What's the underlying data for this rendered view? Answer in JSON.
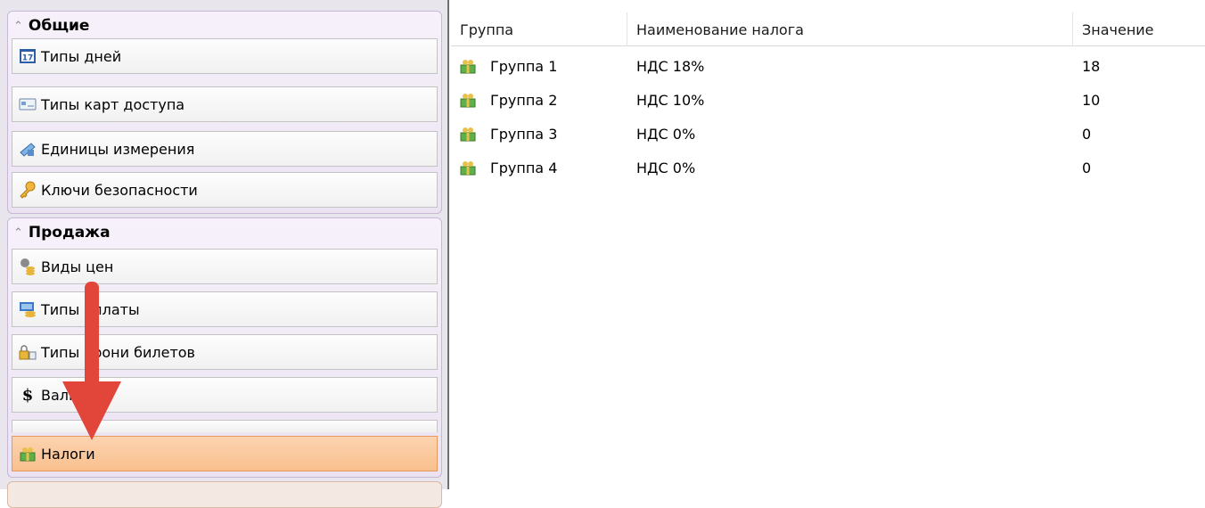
{
  "nav": {
    "general": {
      "title": "Общие",
      "items": [
        {
          "label": "Типы дней",
          "icon": "calendar-icon"
        },
        {
          "label": "Типы карт доступа",
          "icon": "access-card-icon"
        },
        {
          "label": "Единицы измерения",
          "icon": "measure-units-icon"
        },
        {
          "label": "Ключи безопасности",
          "icon": "key-icon"
        }
      ]
    },
    "sales": {
      "title": "Продажа",
      "items": [
        {
          "label": "Виды цен",
          "icon": "coins-icon"
        },
        {
          "label": "Типы оплаты",
          "icon": "payment-icon"
        },
        {
          "label": "Типы брони билетов",
          "icon": "lock-tickets-icon"
        },
        {
          "label": "Валюта",
          "icon": "dollar-icon"
        },
        {
          "label": "Налоги",
          "icon": "tax-gift-icon",
          "selected": true
        }
      ]
    }
  },
  "grid": {
    "columns": [
      "Группа",
      "Наименование налога",
      "Значение"
    ],
    "rows": [
      {
        "group": "Группа 1",
        "name": "НДС 18%",
        "value": "18"
      },
      {
        "group": "Группа 2",
        "name": "НДС 10%",
        "value": "10"
      },
      {
        "group": "Группа 3",
        "name": "НДС 0%",
        "value": "0"
      },
      {
        "group": "Группа 4",
        "name": "НДС 0%",
        "value": "0"
      }
    ]
  },
  "colors": {
    "selected_bg": "#f9c08e",
    "arrow": "#e2463a",
    "panel_bg": "#e9e5ec"
  }
}
